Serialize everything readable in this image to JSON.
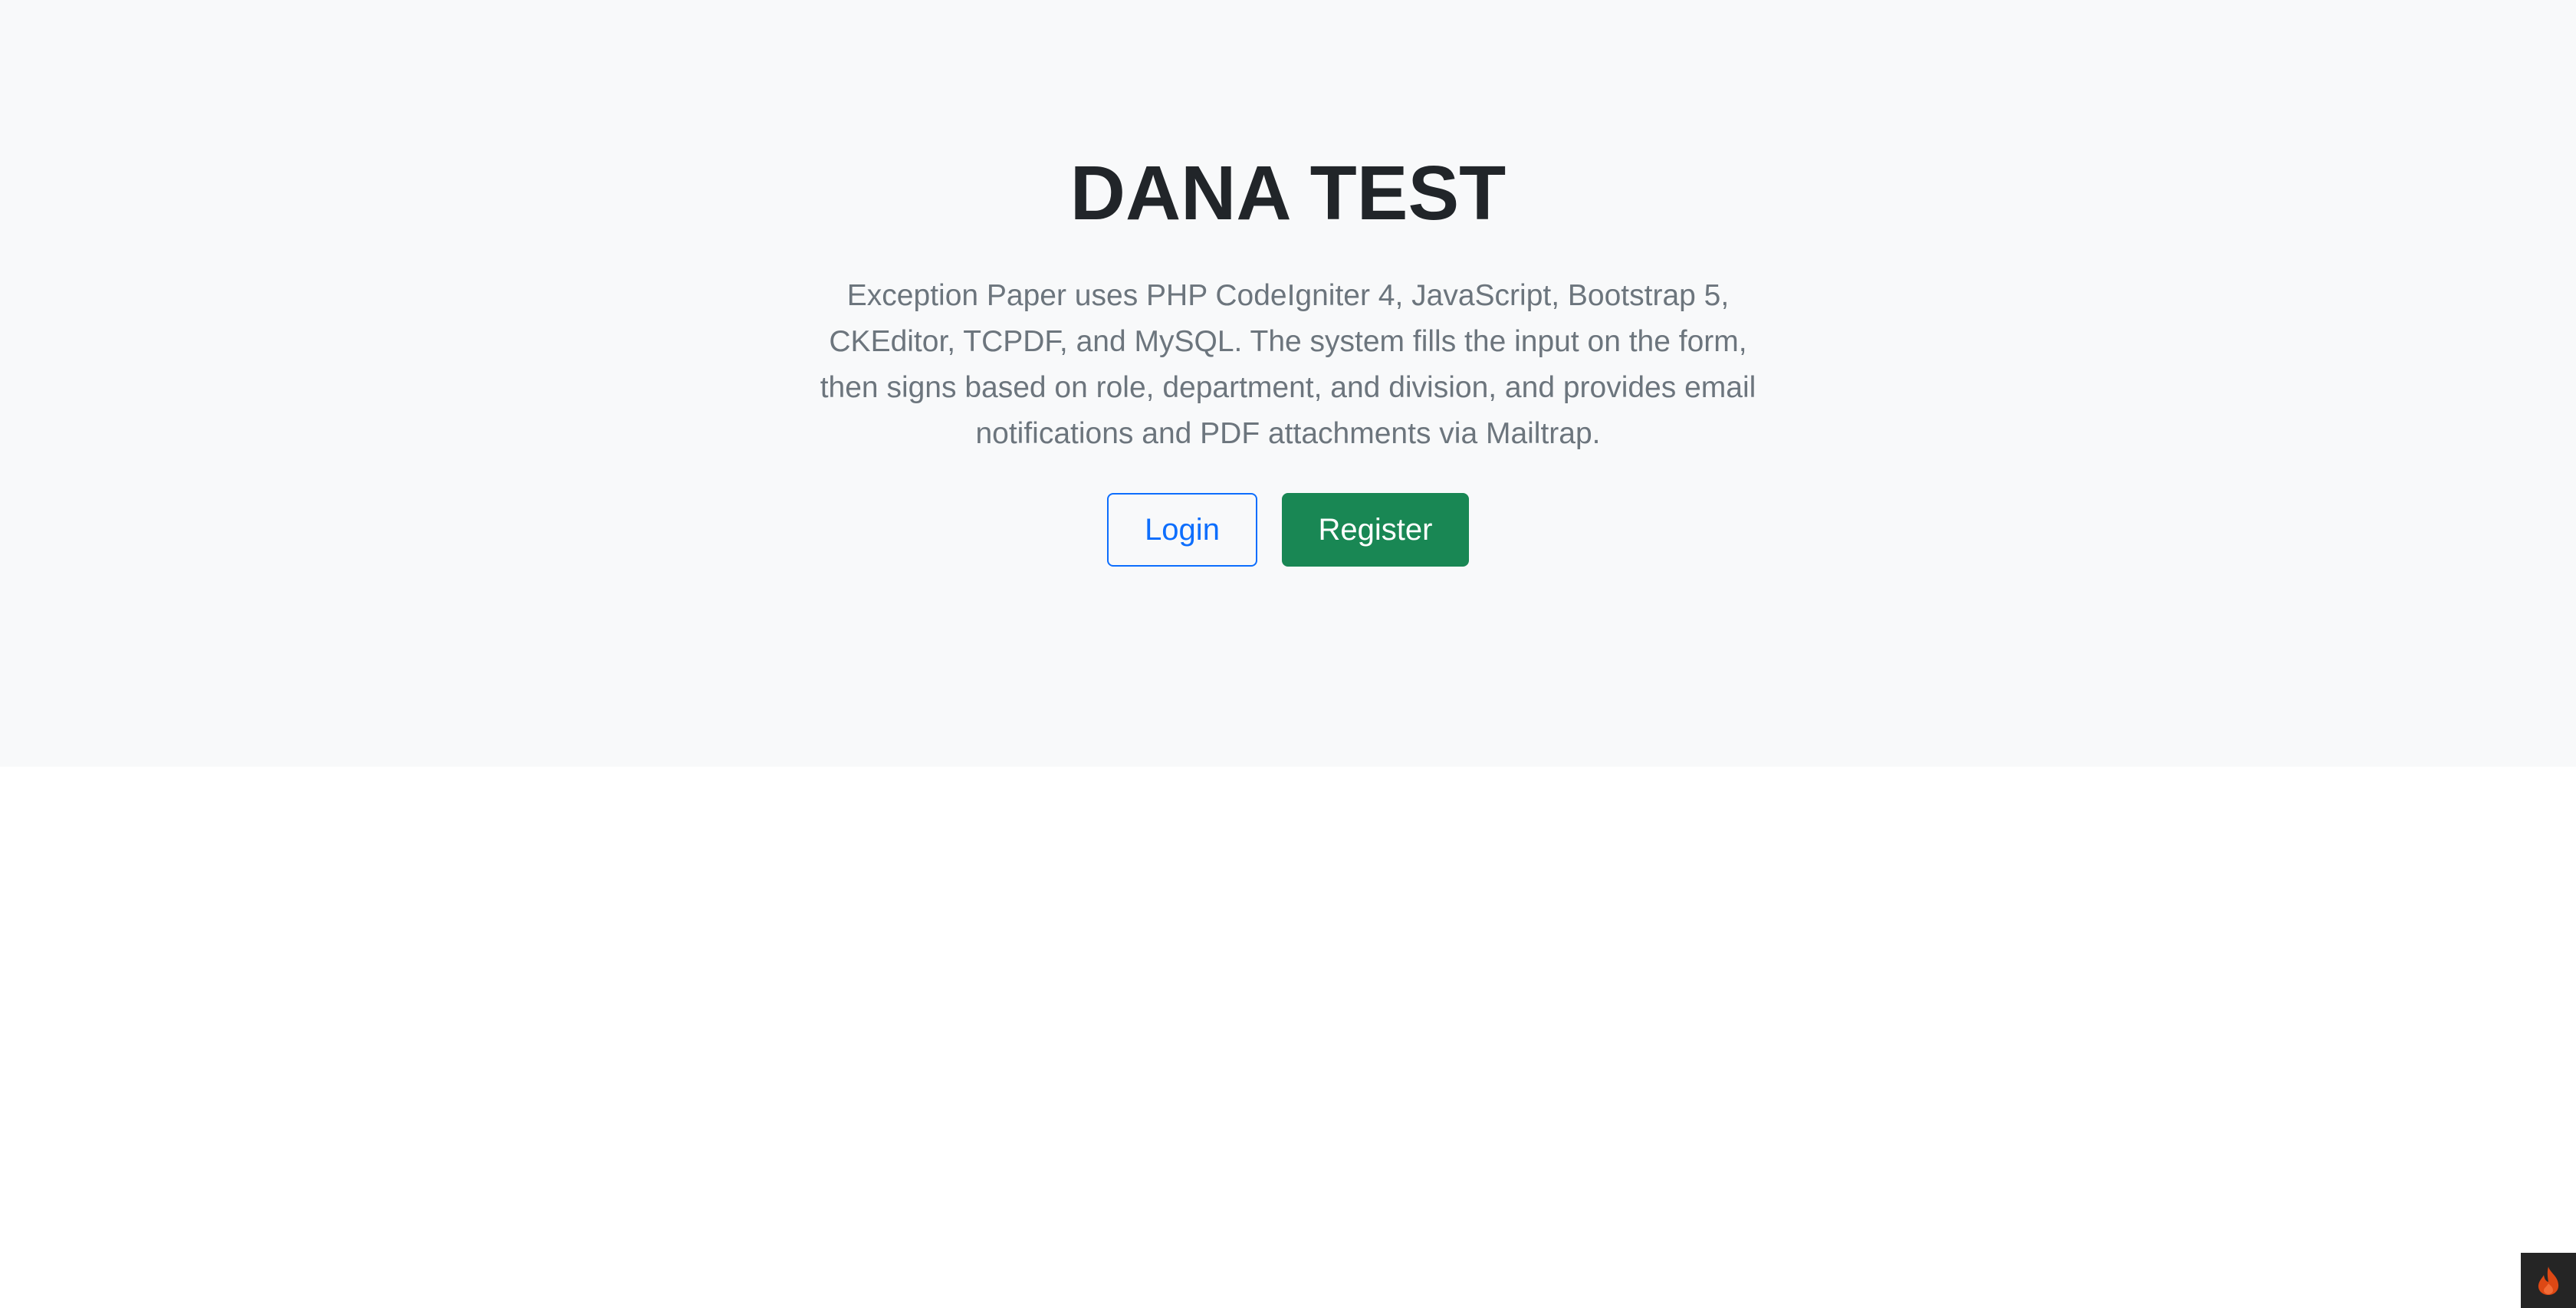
{
  "hero": {
    "title": "DANA TEST",
    "lead": "Exception Paper uses PHP CodeIgniter 4, JavaScript, Bootstrap 5, CKEditor, TCPDF, and MySQL. The system fills the input on the form, then signs based on role, department, and division, and provides email notifications and PDF attachments via Mailtrap."
  },
  "actions": {
    "login_label": "Login",
    "register_label": "Register"
  },
  "colors": {
    "hero_background": "#f8f9fa",
    "title": "#212529",
    "lead": "#6c757d",
    "login_outline": "#0d6efd",
    "register_fill": "#198754",
    "debug_toolbar_background": "#252525",
    "debug_icon": "#dd4814"
  },
  "icons": {
    "debug_toolbar": "codeigniter-flame-icon"
  }
}
